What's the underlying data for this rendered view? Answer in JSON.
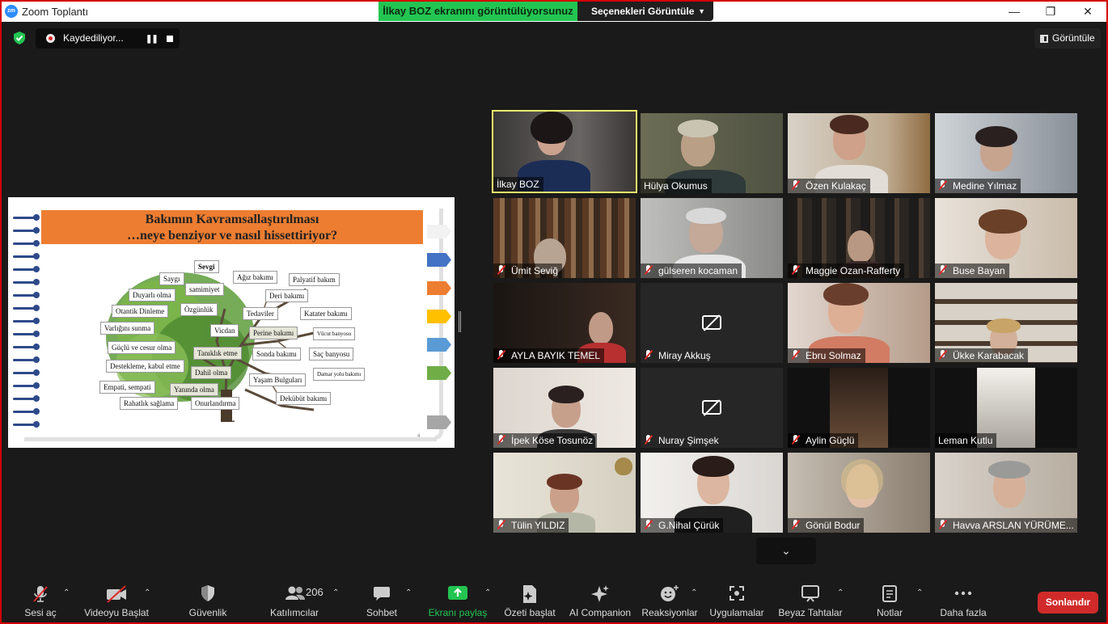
{
  "titlebar": {
    "logo": "zm",
    "app_title": "Zoom Toplantı",
    "share_banner": "İlkay BOZ ekranını görüntülüyorsunuz",
    "view_options": "Seçenekleri Görüntüle",
    "min": "—",
    "restore": "❐",
    "close": "✕"
  },
  "statusbar": {
    "recording": "Kaydediliyor...",
    "view": "Görüntüle"
  },
  "slide": {
    "title_line1": "Bakımın Kavramsallaştırılması",
    "title_line2": "…neye benziyor ve nasıl hissettiriyor?",
    "page_number": "4",
    "words": [
      "Sevgi",
      "Saygı",
      "samimiyet",
      "Duyarlı olma",
      "Özgünlük",
      "Otantik Dinleme",
      "Varlığını sunma",
      "Vicdan",
      "Güçlü ve cesur olma",
      "Tanıklık etme",
      "Destekleme, kabul etme",
      "Dahil olma",
      "Empati, sempati",
      "Yanında olma",
      "Rahatlık sağlama",
      "Onurlandırma",
      "Ağız bakımı",
      "Palyatif bakım",
      "Deri bakımı",
      "Tedaviler",
      "Katater bakımı",
      "Perine bakımı",
      "Vücut banyosu",
      "Sonda bakımı",
      "Saç banyosu",
      "Damar yolu bakımı",
      "Yaşam Bulguları",
      "Dekübüt bakımı"
    ],
    "tab_colors": [
      "#f2f2f2",
      "#4472c4",
      "#ed7d31",
      "#ffc000",
      "#5b9bd5",
      "#70ad47",
      "#a6a6a6"
    ]
  },
  "participants": [
    {
      "name": "İlkay BOZ",
      "muted": false
    },
    {
      "name": "Hülya Okumus",
      "muted": false
    },
    {
      "name": "Özen Kulakaç",
      "muted": true
    },
    {
      "name": "Medine Yılmaz",
      "muted": true
    },
    {
      "name": "Ümit Seviğ",
      "muted": true
    },
    {
      "name": "gülseren kocaman",
      "muted": true
    },
    {
      "name": "Maggie Ozan-Rafferty",
      "muted": true
    },
    {
      "name": "Buse Bayan",
      "muted": true
    },
    {
      "name": "AYLA BAYIK TEMEL",
      "muted": true
    },
    {
      "name": "Miray Akkuş",
      "muted": true
    },
    {
      "name": "Ebru Solmaz",
      "muted": true
    },
    {
      "name": "Ükke Karabacak",
      "muted": true
    },
    {
      "name": "İpek Köse Tosunöz",
      "muted": true
    },
    {
      "name": "Nuray Şimşek",
      "muted": true
    },
    {
      "name": "Aylin Güçlü",
      "muted": true
    },
    {
      "name": "Leman Kutlu",
      "muted": false
    },
    {
      "name": "Tülin YILDIZ",
      "muted": true
    },
    {
      "name": "G.Nihal Çürük",
      "muted": true
    },
    {
      "name": "Gönül Bodur",
      "muted": true
    },
    {
      "name": "Havva ARSLAN YÜRÜME...",
      "muted": true
    }
  ],
  "toolbar": {
    "unmute": "Sesi aç",
    "start_video": "Videoyu Başlat",
    "security": "Güvenlik",
    "participants": "Katılımcılar",
    "participant_count": "206",
    "chat": "Sohbet",
    "share_screen": "Ekranı paylaş",
    "summary": "Özeti başlat",
    "ai_companion": "AI Companion",
    "reactions": "Reaksiyonlar",
    "apps": "Uygulamalar",
    "whiteboard": "Beyaz Tahtalar",
    "notes": "Notlar",
    "more": "Daha fazla",
    "end": "Sonlandır"
  }
}
